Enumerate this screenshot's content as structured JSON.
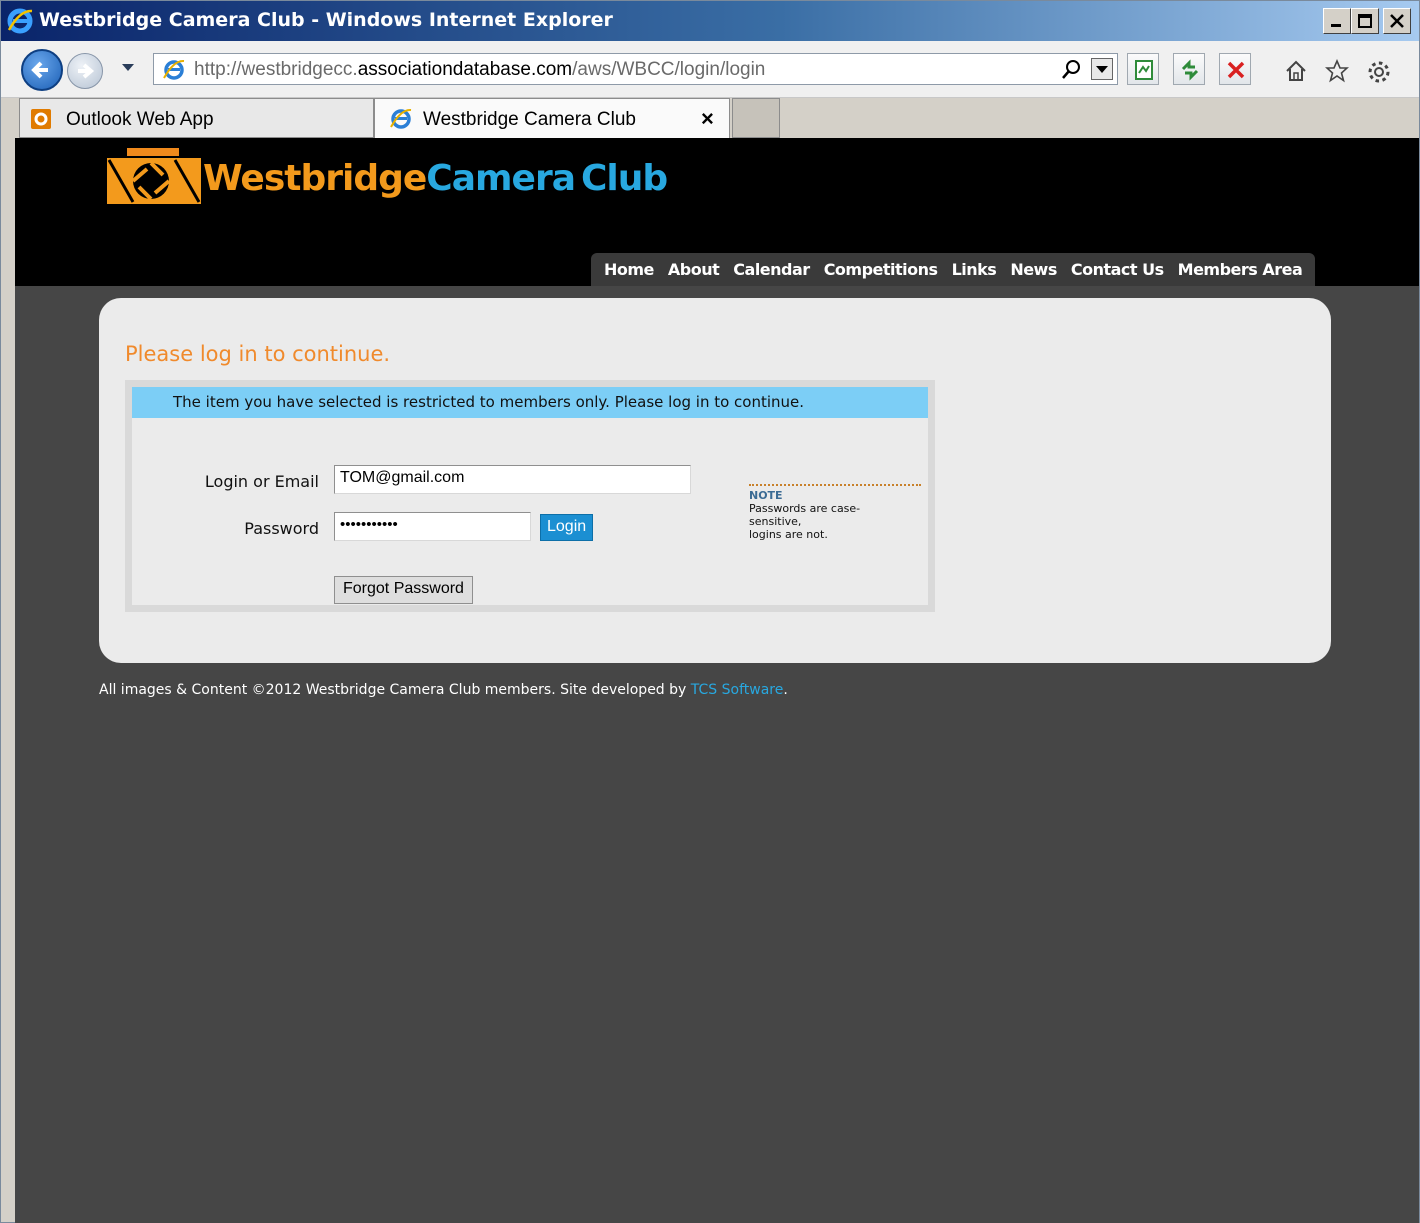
{
  "browser": {
    "window_title": "Westbridge Camera Club - Windows Internet Explorer",
    "url_prefix": "http://westbridgecc.",
    "url_domain": "associationdatabase.com",
    "url_path": "/aws/WBCC/login/login",
    "tabs": [
      {
        "label": "Outlook Web App",
        "icon": "outlook-icon"
      },
      {
        "label": "Westbridge Camera Club",
        "icon": "ie-icon",
        "close": "×"
      }
    ]
  },
  "site": {
    "logo_word1": "Westbridge",
    "logo_word2": "Camera",
    "logo_word3": "Club",
    "nav": [
      "Home",
      "About",
      "Calendar",
      "Competitions",
      "Links",
      "News",
      "Contact Us",
      "Members Area"
    ],
    "colors": {
      "accent_orange": "#f08a2c",
      "accent_blue": "#28a8e0",
      "notice_bg": "#7ccef6"
    }
  },
  "login": {
    "heading": "Please log in to continue.",
    "notice": "The item you have selected is restricted to members only. Please log in to continue.",
    "email_label": "Login or Email",
    "email_value": "TOM@gmail.com",
    "password_label": "Password",
    "password_value": "•••••••••••",
    "login_button": "Login",
    "forgot_button": "Forgot Password",
    "note_title": "NOTE",
    "note_line1": "Passwords are case-",
    "note_line2": "sensitive,",
    "note_line3": "logins are not."
  },
  "footer": {
    "text": "All images & Content ©2012 Westbridge Camera Club members.  Site developed by ",
    "link": "TCS Software",
    "end": "."
  }
}
